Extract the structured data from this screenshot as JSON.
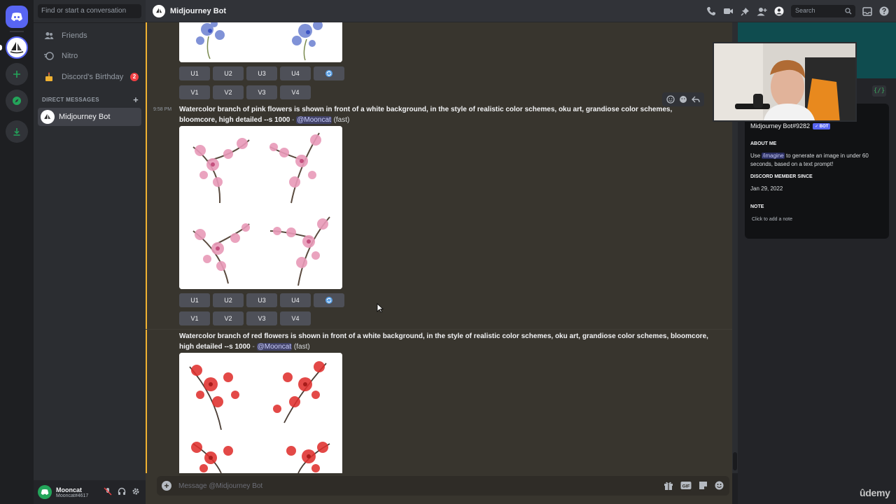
{
  "sidebar": {
    "search_placeholder": "Find or start a conversation",
    "items": {
      "friends": "Friends",
      "nitro": "Nitro",
      "birthday": "Discord's Birthday",
      "birthday_badge": "2"
    },
    "dm_header": "DIRECT MESSAGES",
    "dm_add": "+",
    "dms": [
      {
        "name": "Midjourney Bot"
      }
    ]
  },
  "user_panel": {
    "name": "Mooncat",
    "tag": "Mooncat#4617"
  },
  "topbar": {
    "title": "Midjourney Bot",
    "search_placeholder": "Search"
  },
  "buttons": {
    "u1": "U1",
    "u2": "U2",
    "u3": "U3",
    "u4": "U4",
    "v1": "V1",
    "v2": "V2",
    "v3": "V3",
    "v4": "V4"
  },
  "messages": [
    {
      "time": "9:58 PM",
      "prompt": "Watercolor branch of pink flowers is shown in front of a white background, in the style of realistic color schemes, oku art, grandiose color schemes, bloomcore, high detailed --s 1000",
      "separator": "-",
      "mention": "@Mooncat",
      "speed": "(fast)"
    },
    {
      "prompt": "Watercolor branch of red flowers is shown in front of a white background, in the style of realistic color schemes, oku art, grandiose color schemes, bloomcore, high detailed --s 1000",
      "separator": "-",
      "mention": "@Mooncat",
      "speed": "(fast)"
    }
  ],
  "input": {
    "placeholder": "Message @Midjourney Bot"
  },
  "profile": {
    "name": "Midjourney Bot#9282",
    "bot_badge": "✓ BOT",
    "about_title": "ABOUT ME",
    "about_pre": "Use",
    "about_cmd": "/imagine",
    "about_post": "to generate an image in under 60 seconds, based on a text prompt!",
    "since_title": "DISCORD MEMBER SINCE",
    "since": "Jan 29, 2022",
    "note_title": "NOTE",
    "note_placeholder": "Click to add a note",
    "dev_icon_label": "{/}"
  },
  "watermark": "ûdemy",
  "colors": {
    "accent": "#5865f2",
    "highlight_bar": "#f0b232",
    "badge_red": "#f23f43",
    "online_green": "#23a55a"
  }
}
